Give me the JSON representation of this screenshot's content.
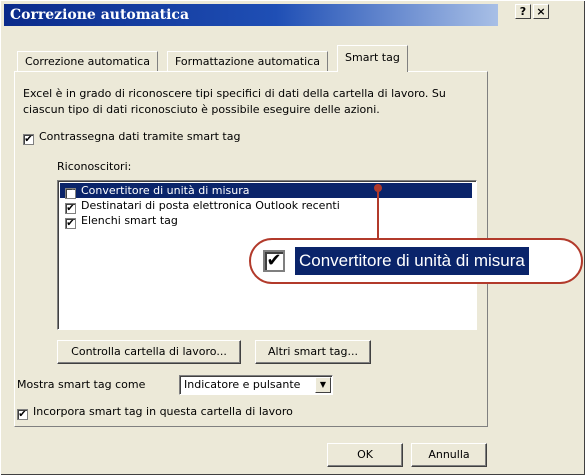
{
  "dialog": {
    "title": "Correzione automatica",
    "help_button": "?",
    "close_button": "×"
  },
  "tabs": [
    {
      "label": "Correzione automatica",
      "active": false
    },
    {
      "label": "Formattazione automatica",
      "active": false
    },
    {
      "label": "Smart tag",
      "active": true
    }
  ],
  "panel": {
    "description": "Excel è in grado di riconoscere tipi specifici di dati della cartella di lavoro. Su ciascun tipo di dati riconosciuto è possibile eseguire delle azioni.",
    "label_data_tags": "Contrassegna dati tramite smart tag",
    "label_data_tags_checked": true,
    "recognizers_label": "Riconoscitori:",
    "recognizers": [
      {
        "label": "Convertitore di unità di misura",
        "checked": true,
        "selected": true
      },
      {
        "label": "Destinatari di posta elettronica Outlook recenti",
        "checked": true,
        "selected": false
      },
      {
        "label": "Elenchi smart tag",
        "checked": true,
        "selected": false
      }
    ],
    "check_workbook_button": "Controlla cartella di lavoro...",
    "more_tags_button": "Altri smart tag...",
    "show_as_label": "Mostra smart tag come",
    "show_as_value": "Indicatore e pulsante",
    "embed_label": "Incorpora smart tag in questa cartella di lavoro",
    "embed_checked": true
  },
  "footer": {
    "ok_button": "OK",
    "cancel_button": "Annulla"
  },
  "callout": {
    "label": "Convertitore di unità di misura",
    "checked": true
  },
  "glyphs": {
    "check": "✔",
    "dropdown": "▼"
  },
  "colors": {
    "accent": "#b23a2b",
    "selection": "#0a246a",
    "title_start": "#0a2a8a"
  }
}
